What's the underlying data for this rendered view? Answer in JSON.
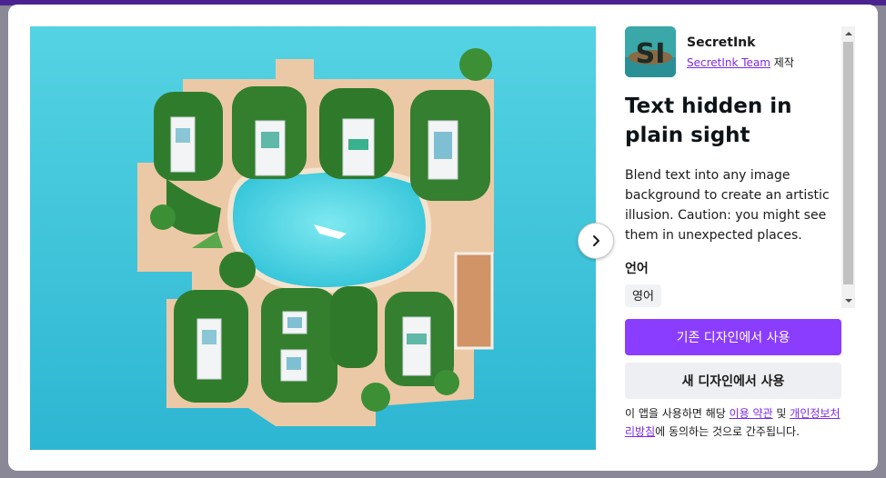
{
  "app": {
    "name": "SecretInk",
    "logo_text": "SI",
    "by_link": "SecretInk Team",
    "by_suffix": " 제작",
    "title": "Text hidden in plain sight",
    "description": "Blend text into any image background to create an artistic illusion. Caution: you might see them in unexpected places."
  },
  "language": {
    "label": "언어",
    "value": "영어"
  },
  "buttons": {
    "use_existing": "기존 디자인에서 사용",
    "use_new": "새 디자인에서 사용"
  },
  "terms": {
    "prefix": "이 앱을 사용하면 해당 ",
    "terms_link": "이용 약관",
    "and": " 및 ",
    "privacy_link": "개인정보처리방침",
    "suffix": "에 동의하는 것으로 간주됩니다."
  },
  "icons": {
    "next": "chevron-right-icon",
    "scroll_up": "arrow-up-icon",
    "scroll_down": "arrow-down-icon"
  },
  "colors": {
    "accent": "#8b3dff",
    "link": "#7d2ae8",
    "ocean": "#3fc9de",
    "sand": "#ecc9a6",
    "foliage": "#2f7d2c"
  }
}
